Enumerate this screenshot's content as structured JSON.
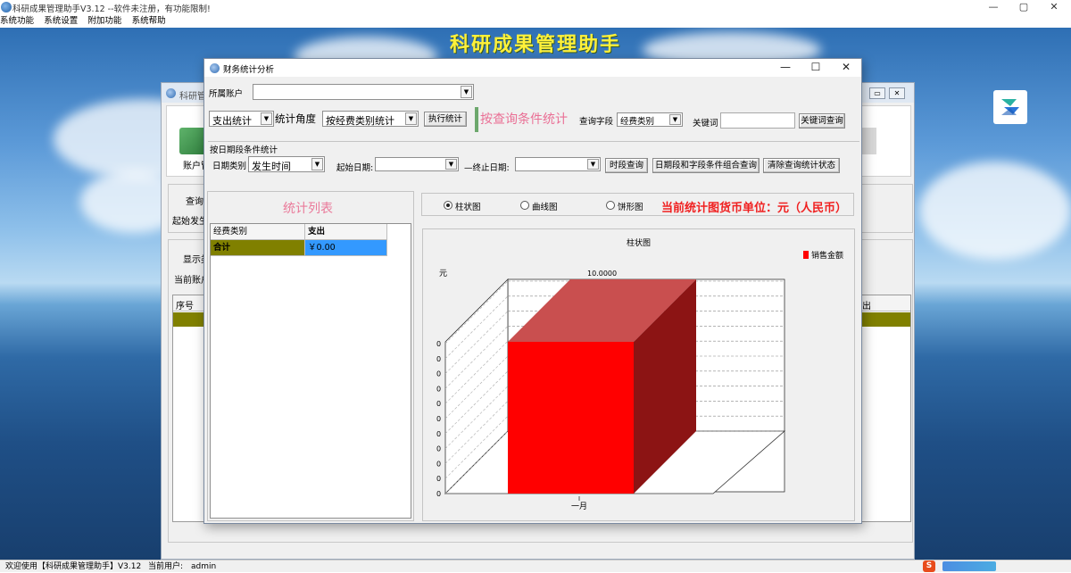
{
  "app": {
    "window_title": "科研成果管理助手V3.12 --软件未注册，有功能限制!",
    "banner_title": "科研成果管理助手",
    "menu": [
      "系统功能",
      "系统设置",
      "附加功能",
      "系统帮助"
    ],
    "window_controls": {
      "minimize": "—",
      "maximize": "▢",
      "close": "✕"
    }
  },
  "background_window": {
    "title": "科研管",
    "labels": {
      "account_mgmt": "账户管",
      "query": "查询",
      "start_occur": "起始发生",
      "show": "显示类",
      "current_account": "当前账户",
      "col_index": "序号",
      "col_expense_tail": "出"
    },
    "controls": {
      "restore": "▭",
      "close": "✕"
    }
  },
  "dialog": {
    "title": "财务统计分析",
    "controls": {
      "minimize": "—",
      "maximize": "☐",
      "close": "✕"
    },
    "account_label": "所属账户",
    "account_value": "",
    "stat_type": "支出统计",
    "stat_angle_label": "统计角度",
    "stat_by": "按经费类别统计",
    "run_stat_button": "执行统计",
    "query_hint": "按查询条件统计",
    "query_field_label": "查询字段",
    "query_field_value": "经费类别",
    "keyword_label": "关键词",
    "keyword_value": "",
    "keyword_query_button": "关键词查询",
    "date_group_label": "按日期段条件统计",
    "date_type_label": "日期类别",
    "date_type_value": "发生时间",
    "start_date_label": "起始日期:",
    "start_date_value": "",
    "end_date_label": "—终止日期:",
    "end_date_value": "",
    "period_query_button": "时段查询",
    "combo_query_button": "日期段和字段条件组合查询",
    "clear_query_button": "清除查询统计状态",
    "stat_list_title": "统计列表",
    "table": {
      "headers": [
        "经费类别",
        "支出"
      ],
      "rows": [
        [
          "合计",
          "￥0.00"
        ]
      ]
    },
    "chart_options": {
      "options": [
        "柱状图",
        "曲线图",
        "饼形图"
      ],
      "selected": "柱状图"
    },
    "currency_note": "当前统计图货币单位：元（人民币）"
  },
  "chart_data": {
    "type": "bar",
    "title": "柱状图",
    "ylabel": "元",
    "categories": [
      "一月"
    ],
    "series": [
      {
        "name": "销售金额",
        "values": [
          10.0
        ]
      }
    ],
    "data_label": "10.0000",
    "y_tick_labels": [
      "0",
      "0",
      "0",
      "0",
      "0",
      "0",
      "0",
      "0",
      "0",
      "0",
      "0"
    ],
    "legend_position": "top-right",
    "colors": {
      "front": "#ff0000",
      "top": "#c94f4f",
      "side": "#8c1414"
    }
  },
  "statusbar": {
    "welcome": "欢迎使用【科研成果管理助手】V3.12",
    "current_user_label": "当前用户:",
    "current_user": "admin"
  }
}
